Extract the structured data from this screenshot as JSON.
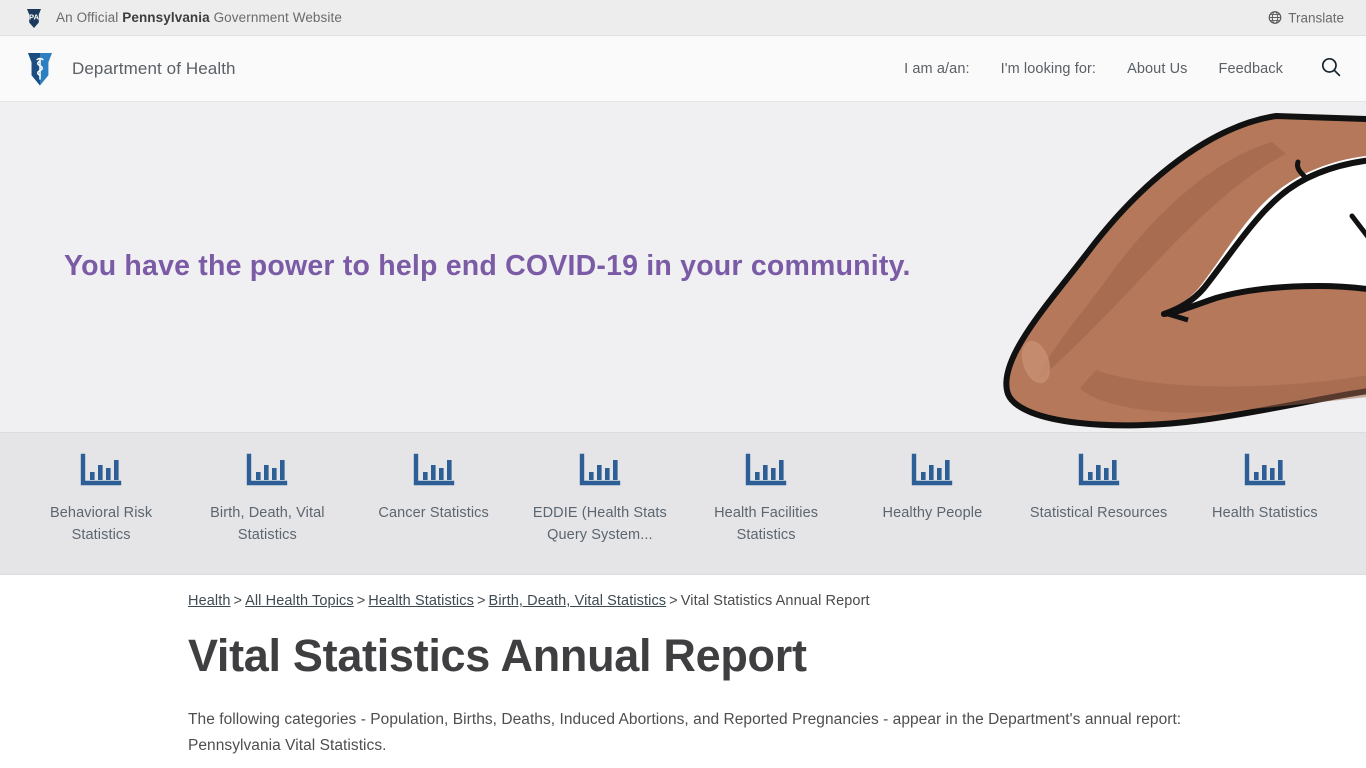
{
  "gov_bar": {
    "notice_prefix": "An Official ",
    "notice_bold": "Pennsylvania",
    "notice_suffix": " Government Website",
    "logo_text": "PA",
    "translate_label": "Translate"
  },
  "header": {
    "brand_name": "Department of Health",
    "nav": [
      {
        "label": "I am a/an:"
      },
      {
        "label": "I'm looking for:"
      },
      {
        "label": "About Us"
      },
      {
        "label": "Feedback"
      }
    ],
    "search_icon": "search-icon"
  },
  "hero": {
    "headline": "You have the power to help end COVID-19 in your community.",
    "headline_color": "#7b5ba6",
    "background_color": "#f0f0f2",
    "illustration": "flexed-arm-illustration",
    "arm_color": "#b5785b",
    "arm_shadow_color": "#9d6349"
  },
  "stats_band": {
    "background_color": "#e5e5e7",
    "icon_color": "#2d5f96",
    "tiles": [
      {
        "label": "Behavioral Risk Statistics",
        "icon": "bar-chart-icon"
      },
      {
        "label": "Birth, Death, Vital Statistics",
        "icon": "bar-chart-icon"
      },
      {
        "label": "Cancer Statistics",
        "icon": "bar-chart-icon"
      },
      {
        "label": "EDDIE (Health Stats Query System...",
        "icon": "bar-chart-icon"
      },
      {
        "label": "Health Facilities Statistics",
        "icon": "bar-chart-icon"
      },
      {
        "label": "Healthy People",
        "icon": "bar-chart-icon"
      },
      {
        "label": "Statistical Resources",
        "icon": "bar-chart-icon"
      },
      {
        "label": "Health Statistics",
        "icon": "bar-chart-icon"
      }
    ]
  },
  "breadcrumb": {
    "separator": ">",
    "items": [
      {
        "label": "Health",
        "is_link": true
      },
      {
        "label": "All Health Topics",
        "is_link": true
      },
      {
        "label": "Health Statistics",
        "is_link": true
      },
      {
        "label": "Birth, Death, Vital Statistics",
        "is_link": true
      },
      {
        "label": "Vital Statistics Annual Report",
        "is_link": false
      }
    ]
  },
  "main": {
    "page_title": "Vital Statistics Annual Report",
    "intro_paragraph": "The following categories - Population, Births, Deaths, Induced Abortions, and Reported Pregnancies - appear in the Department's annual report: Pennsylvania Vital Statistics."
  }
}
